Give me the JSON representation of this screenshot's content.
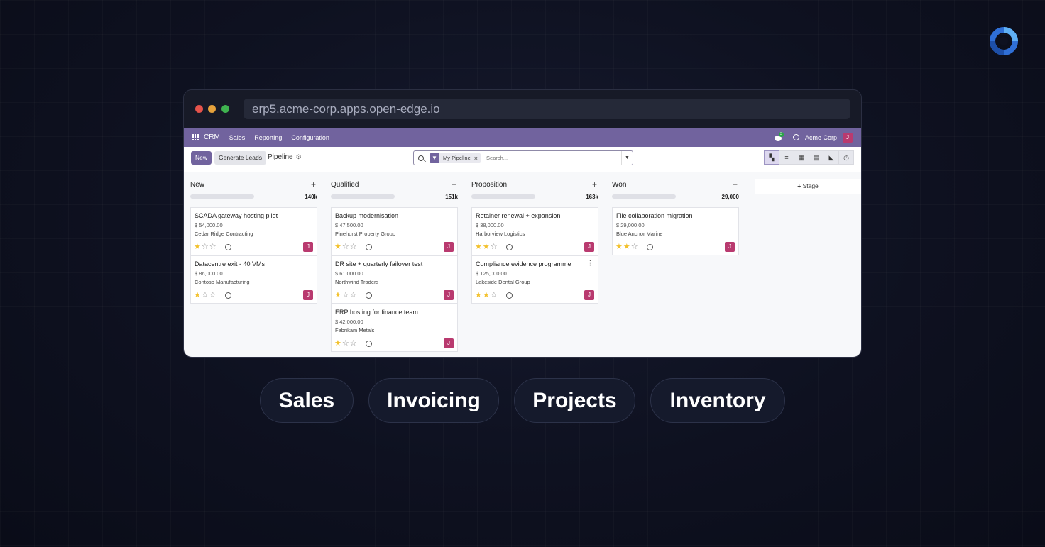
{
  "browser": {
    "url": "erp5.acme-corp.apps.open-edge.io"
  },
  "navbar": {
    "app_name": "CRM",
    "menu": [
      "Sales",
      "Reporting",
      "Configuration"
    ],
    "chat_count": "3",
    "company": "Acme Corp",
    "user_initial": "J"
  },
  "control": {
    "new_label": "New",
    "generate_label": "Generate Leads",
    "breadcrumb": "Pipeline",
    "facet_label": "My Pipeline",
    "search_placeholder": "Search..."
  },
  "columns": [
    {
      "name": "New",
      "total": "140k",
      "cards": [
        {
          "title": "SCADA gateway hosting pilot",
          "amount": "$ 54,000.00",
          "company": "Cedar Ridge Contracting",
          "stars": 1,
          "avatar": "J"
        },
        {
          "title": "Datacentre exit - 40 VMs",
          "amount": "$ 86,000.00",
          "company": "Contoso Manufacturing",
          "stars": 1,
          "avatar": "J"
        }
      ]
    },
    {
      "name": "Qualified",
      "total": "151k",
      "cards": [
        {
          "title": "Backup modernisation",
          "amount": "$ 47,500.00",
          "company": "Pinehurst Property Group",
          "stars": 1,
          "avatar": "J"
        },
        {
          "title": "DR site + quarterly failover test",
          "amount": "$ 61,000.00",
          "company": "Northwind Traders",
          "stars": 1,
          "avatar": "J"
        },
        {
          "title": "ERP hosting for finance team",
          "amount": "$ 42,000.00",
          "company": "Fabrikam Metals",
          "stars": 1,
          "avatar": "J"
        }
      ]
    },
    {
      "name": "Proposition",
      "total": "163k",
      "cards": [
        {
          "title": "Retainer renewal + expansion",
          "amount": "$ 38,000.00",
          "company": "Harborview Logistics",
          "stars": 2,
          "avatar": "J"
        },
        {
          "title": "Compliance evidence programme",
          "amount": "$ 125,000.00",
          "company": "Lakeside Dental Group",
          "stars": 2,
          "avatar": "J"
        }
      ]
    },
    {
      "name": "Won",
      "total": "29,000",
      "cards": [
        {
          "title": "File collaboration migration",
          "amount": "$ 29,000.00",
          "company": "Blue Anchor Marine",
          "stars": 2,
          "avatar": "J"
        }
      ]
    }
  ],
  "add_stage_label": "Stage",
  "pills": [
    "Sales",
    "Invoicing",
    "Projects",
    "Inventory"
  ],
  "colors": {
    "brand": "#71639e",
    "avatar": "#b93a6f",
    "star": "#f3c12c"
  }
}
